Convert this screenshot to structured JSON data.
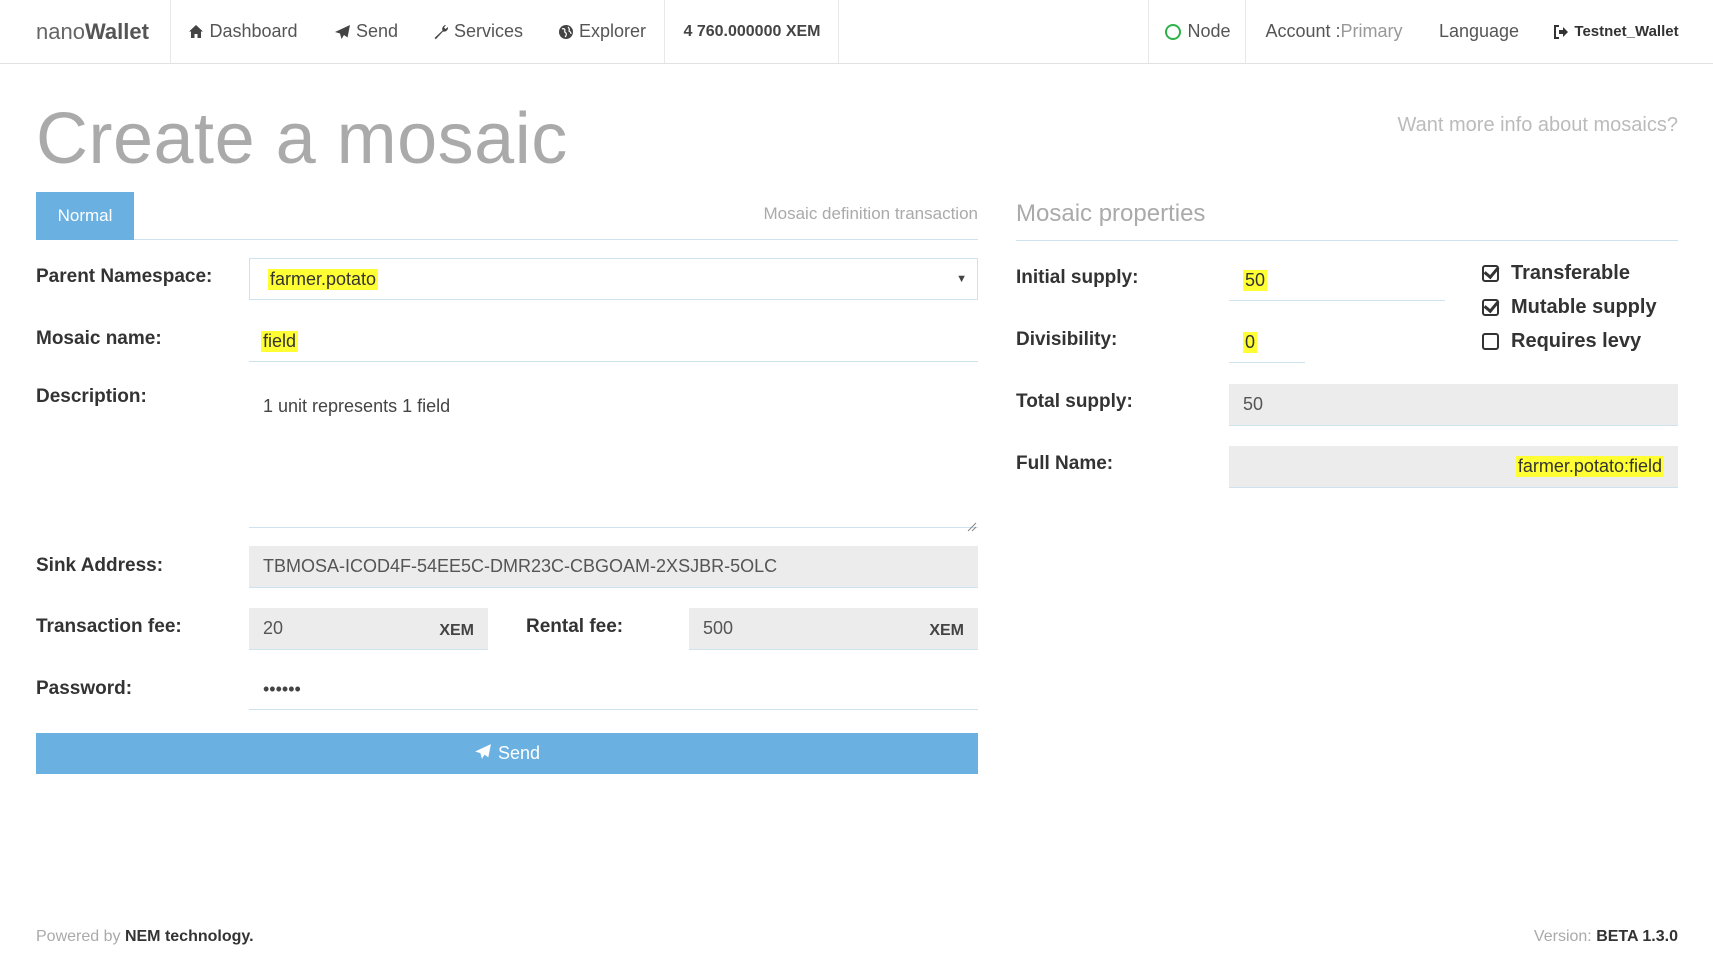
{
  "navbar": {
    "brand_prefix": "nano",
    "brand_suffix": "Wallet",
    "dashboard": "Dashboard",
    "send": "Send",
    "services": "Services",
    "explorer": "Explorer",
    "balance": "4 760.000000 XEM",
    "node": "Node",
    "account_label": "Account : ",
    "account_value": "Primary",
    "language": "Language",
    "wallet_name": "Testnet_Wallet",
    "node_status_color": "#2bb34a"
  },
  "header": {
    "title": "Create a mosaic",
    "info_link": "Want more info about mosaics?"
  },
  "form": {
    "tab_normal": "Normal",
    "tab_caption": "Mosaic definition transaction",
    "parent_namespace_label": "Parent Namespace:",
    "parent_namespace_value": "farmer.potato",
    "mosaic_name_label": "Mosaic name:",
    "mosaic_name_value": "field",
    "description_label": "Description:",
    "description_value": "1 unit represents 1 field",
    "sink_address_label": "Sink Address:",
    "sink_address_value": "TBMOSA-ICOD4F-54EE5C-DMR23C-CBGOAM-2XSJBR-5OLC",
    "transaction_fee_label": "Transaction fee:",
    "transaction_fee_value": "20",
    "transaction_fee_unit": "XEM",
    "rental_fee_label": "Rental fee:",
    "rental_fee_value": "500",
    "rental_fee_unit": "XEM",
    "password_label": "Password:",
    "password_value": "••••••",
    "send_button": "Send"
  },
  "properties": {
    "title": "Mosaic properties",
    "initial_supply_label": "Initial supply:",
    "initial_supply_value": "50",
    "divisibility_label": "Divisibility:",
    "divisibility_value": "0",
    "total_supply_label": "Total supply:",
    "total_supply_value": "50",
    "full_name_label": "Full Name:",
    "full_name_value": "farmer.potato:field",
    "transferable_label": "Transferable",
    "transferable_checked": true,
    "mutable_supply_label": "Mutable supply",
    "mutable_supply_checked": true,
    "requires_levy_label": "Requires levy",
    "requires_levy_checked": false
  },
  "footer": {
    "powered_prefix": "Powered by ",
    "powered_brand": "NEM technology.",
    "version_prefix": "Version: ",
    "version_value": "BETA 1.3.0"
  },
  "colors": {
    "accent": "#6ab0e0",
    "highlight": "#ffff33"
  }
}
